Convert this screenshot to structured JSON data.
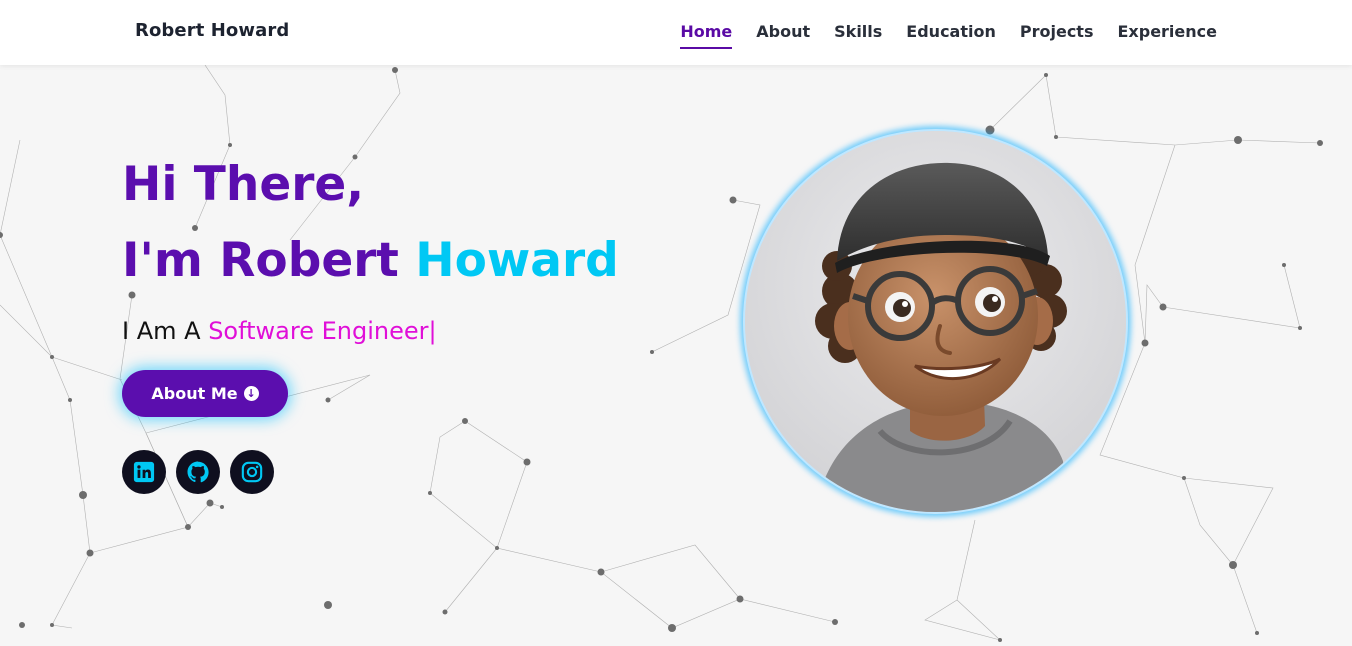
{
  "brand": "Robert Howard",
  "nav": [
    {
      "label": "Home",
      "active": true
    },
    {
      "label": "About",
      "active": false
    },
    {
      "label": "Skills",
      "active": false
    },
    {
      "label": "Education",
      "active": false
    },
    {
      "label": "Projects",
      "active": false
    },
    {
      "label": "Experience",
      "active": false
    }
  ],
  "hero": {
    "greeting": "Hi There,",
    "intro_prefix": "I'm Robert ",
    "intro_highlight": "Howard",
    "role_prefix": "I Am A ",
    "role_typed": "Software Engineer|",
    "button_label": "About Me"
  },
  "socials": [
    {
      "icon": "linkedin-icon"
    },
    {
      "icon": "github-icon"
    },
    {
      "icon": "instagram-icon"
    }
  ],
  "avatar": {
    "icon": "memoji-avatar"
  },
  "colors": {
    "primary": "#5b0eae",
    "accent": "#00c8f4",
    "typed": "#e00fd8",
    "social_bg": "#0f0f1f",
    "social_icon": "#00c8f4"
  }
}
